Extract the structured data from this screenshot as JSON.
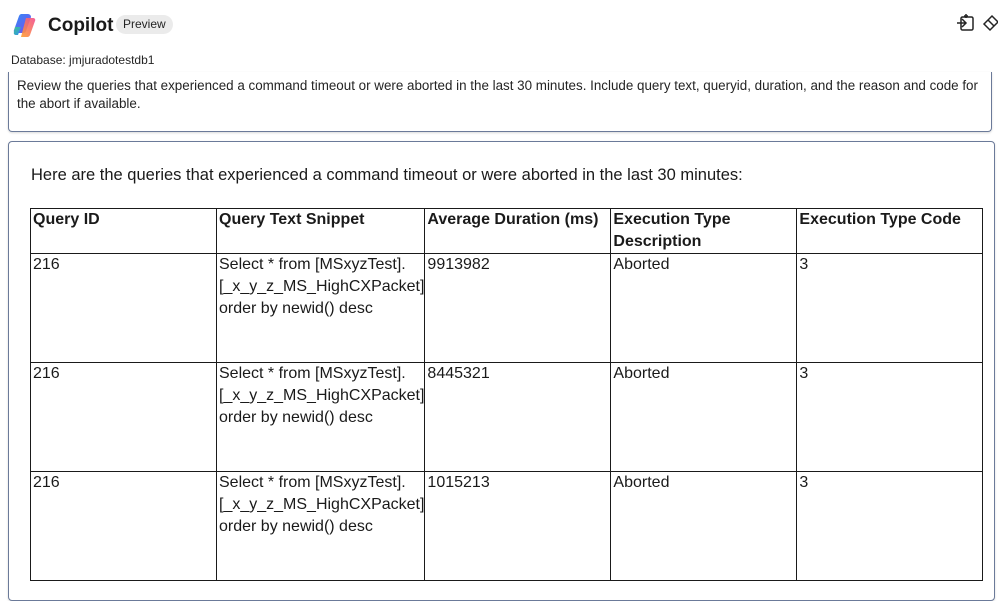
{
  "header": {
    "app_title": "Copilot",
    "badge": "Preview",
    "icons": [
      "copilot-logo",
      "new-chat-icon",
      "clear-icon"
    ]
  },
  "database_line": "Database: jmjuradotestdb1",
  "prompt": {
    "text": "Review the queries that experienced a command timeout or were aborted in the last 30 minutes. Include query text, queryid, duration,  and the reason and code for the abort if available."
  },
  "response": {
    "intro": "Here are the queries that experienced a command timeout or were aborted in the last 30 minutes:",
    "table": {
      "headers": [
        "Query ID",
        "Query Text Snippet",
        "Average Duration (ms)",
        "Execution Type Description",
        "Execution Type Code"
      ],
      "rows": [
        [
          "216",
          "Select * from [MSxyzTest].[_x_y_z_MS_HighCXPacket] order by newid() desc",
          "9913982",
          "Aborted",
          "3"
        ],
        [
          "216",
          "Select * from [MSxyzTest].[_x_y_z_MS_HighCXPacket] order by newid() desc",
          "8445321",
          "Aborted",
          "3"
        ],
        [
          "216",
          "Select * from [MSxyzTest].[_x_y_z_MS_HighCXPacket] order by newid() desc",
          "1015213",
          "Aborted",
          "3"
        ]
      ]
    }
  }
}
